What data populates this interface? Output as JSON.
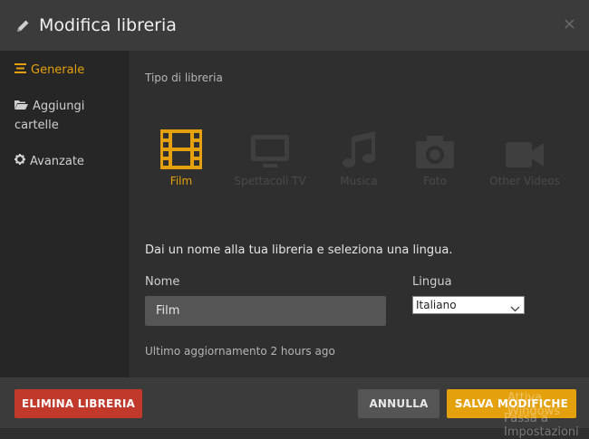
{
  "header": {
    "title": "Modifica libreria",
    "close_symbol": "×"
  },
  "sidebar": {
    "items": [
      {
        "label": "Generale",
        "icon": "list-icon",
        "active": true
      },
      {
        "label_line1": "Aggiungi",
        "label_line2": "cartelle",
        "icon": "folder-open-icon"
      },
      {
        "label": "Avanzate",
        "icon": "gear-icon"
      }
    ]
  },
  "library_type": {
    "label": "Tipo di libreria",
    "types": [
      {
        "label": "Film",
        "icon": "film-icon",
        "selected": true
      },
      {
        "label": "Spettacoli TV",
        "icon": "tv-icon"
      },
      {
        "label": "Musica",
        "icon": "music-icon"
      },
      {
        "label": "Foto",
        "icon": "camera-icon"
      },
      {
        "label": "Other Videos",
        "icon": "video-camera-icon"
      }
    ]
  },
  "form": {
    "prompt": "Dai un nome alla tua libreria e seleziona una lingua.",
    "name_label": "Nome",
    "name_value": "Film",
    "language_label": "Lingua",
    "language_value": "Italiano"
  },
  "updated_text": "Ultimo aggiornamento 2 hours ago",
  "footer": {
    "delete_label": "ELIMINA LIBRERIA",
    "cancel_label": "ANNULLA",
    "save_label": "SALVA MODIFICHE"
  },
  "watermark": {
    "line1": "Attiva Windows",
    "line2": "Passa a Impostazioni"
  },
  "colors": {
    "accent": "#e5a00d",
    "danger": "#c0392b",
    "header_bg": "#3b3b3b",
    "sidebar_bg": "#262626"
  }
}
